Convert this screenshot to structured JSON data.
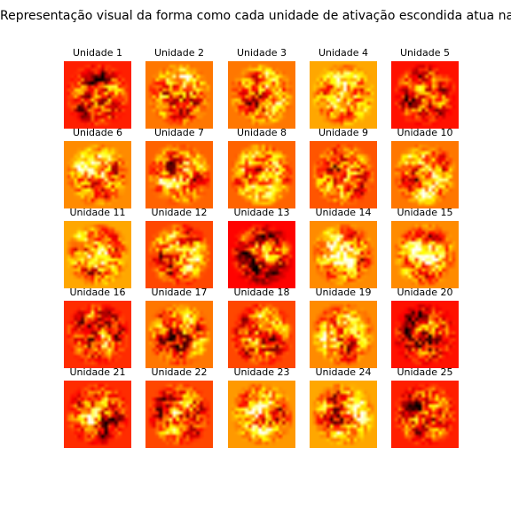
{
  "chart_data": {
    "type": "heatmap",
    "title": "Representação visual da forma como cada unidade de ativação escondida atua na rede",
    "colormap": "hot",
    "grid": {
      "rows": 5,
      "cols": 5
    },
    "axes_visible": false,
    "panels": [
      {
        "title": "Unidade 1"
      },
      {
        "title": "Unidade 2"
      },
      {
        "title": "Unidade 3"
      },
      {
        "title": "Unidade 4"
      },
      {
        "title": "Unidade 5"
      },
      {
        "title": "Unidade 6"
      },
      {
        "title": "Unidade 7"
      },
      {
        "title": "Unidade 8"
      },
      {
        "title": "Unidade 9"
      },
      {
        "title": "Unidade 10"
      },
      {
        "title": "Unidade 11"
      },
      {
        "title": "Unidade 12"
      },
      {
        "title": "Unidade 13"
      },
      {
        "title": "Unidade 14"
      },
      {
        "title": "Unidade 15"
      },
      {
        "title": "Unidade 16"
      },
      {
        "title": "Unidade 17"
      },
      {
        "title": "Unidade 18"
      },
      {
        "title": "Unidade 19"
      },
      {
        "title": "Unidade 20"
      },
      {
        "title": "Unidade 21"
      },
      {
        "title": "Unidade 22"
      },
      {
        "title": "Unidade 23"
      },
      {
        "title": "Unidade 24"
      },
      {
        "title": "Unidade 25"
      }
    ]
  }
}
